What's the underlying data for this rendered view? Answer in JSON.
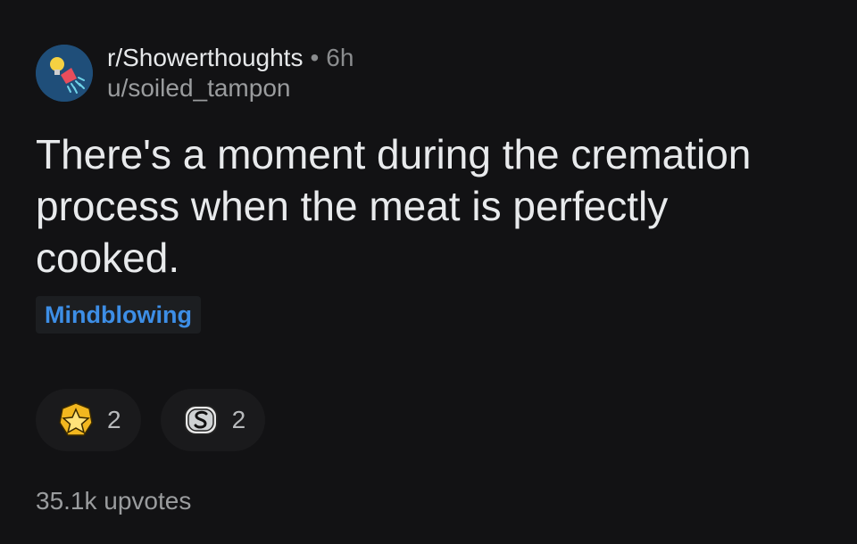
{
  "post": {
    "subreddit": "r/Showerthoughts",
    "separator": "•",
    "time": "6h",
    "username": "u/soiled_tampon",
    "title": "There's a moment during the cremation process when the meat is perfectly cooked.",
    "flair": "Mindblowing",
    "upvotes": "35.1k upvotes"
  },
  "awards": [
    {
      "icon": "star-award-icon",
      "count": "2"
    },
    {
      "icon": "silver-award-icon",
      "count": "2"
    }
  ],
  "colors": {
    "background": "#121214",
    "flair_text": "#3d8ee6",
    "avatar_bg": "#1f4e79"
  }
}
